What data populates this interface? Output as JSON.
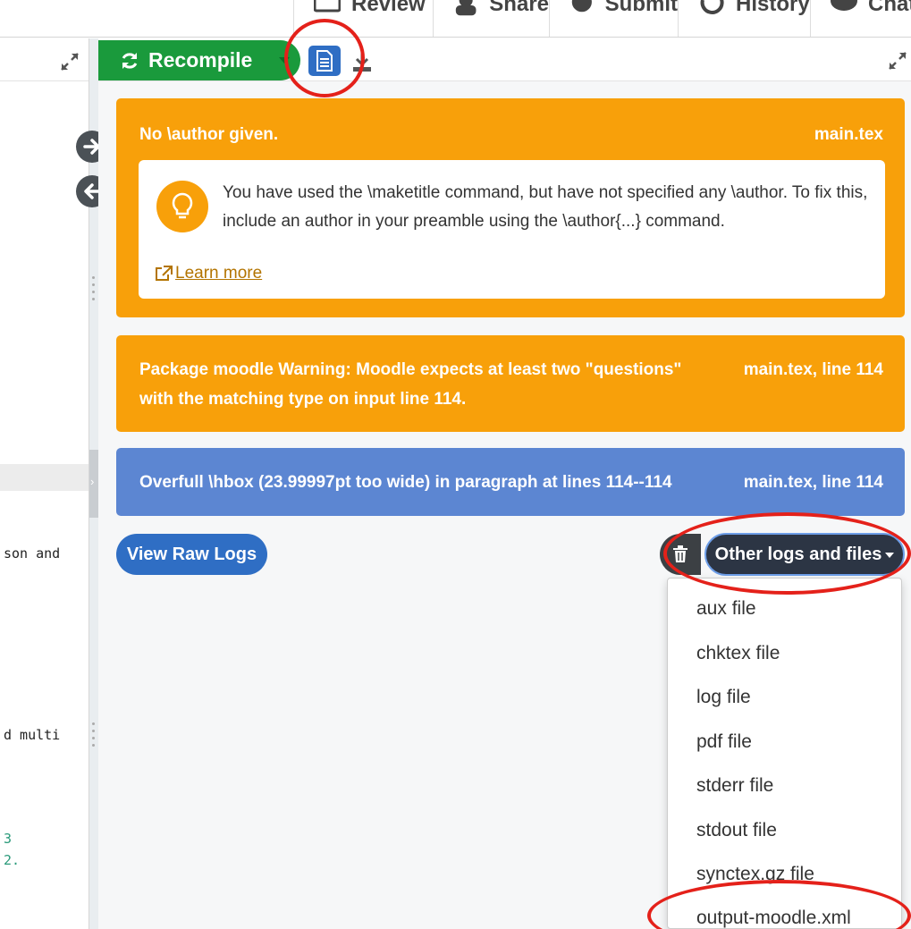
{
  "toolbar": {
    "items": [
      {
        "label": "Review",
        "icon": "review-icon"
      },
      {
        "label": "Share",
        "icon": "share-icon"
      },
      {
        "label": "Submit",
        "icon": "submit-icon"
      },
      {
        "label": "History",
        "icon": "history-icon"
      },
      {
        "label": "Chat",
        "icon": "chat-icon"
      }
    ]
  },
  "editor": {
    "lines": [
      "son and",
      "d multi",
      "3",
      "2."
    ]
  },
  "pdf_toolbar": {
    "recompile_label": "Recompile"
  },
  "logs": [
    {
      "level": "warning",
      "title": "No \\author given.",
      "file": "main.tex",
      "hint": "You have used the \\maketitle command, but have not specified any \\author. To fix this, include an author in your preamble using the \\author{...} command.",
      "learn_more": "Learn more"
    },
    {
      "level": "warning",
      "title": "Package moodle Warning: Moodle expects at least two \"questions\" with the matching type on input line 114.",
      "file": "main.tex, line 114"
    },
    {
      "level": "info",
      "title": "Overfull \\hbox (23.99997pt too wide) in paragraph at lines 114--114",
      "file": "main.tex, line 114"
    }
  ],
  "actions": {
    "view_raw_logs": "View Raw Logs",
    "other_logs": "Other logs and files"
  },
  "dropdown": {
    "items": [
      "aux file",
      "chktex file",
      "log file",
      "pdf file",
      "stderr file",
      "stdout file",
      "synctex.gz file",
      "output-moodle.xml"
    ]
  },
  "colors": {
    "warning": "#f8a00a",
    "info": "#5c86d2",
    "recompile": "#1a9a3c",
    "primary": "#2f6ec4",
    "annotation": "#e4211a"
  }
}
